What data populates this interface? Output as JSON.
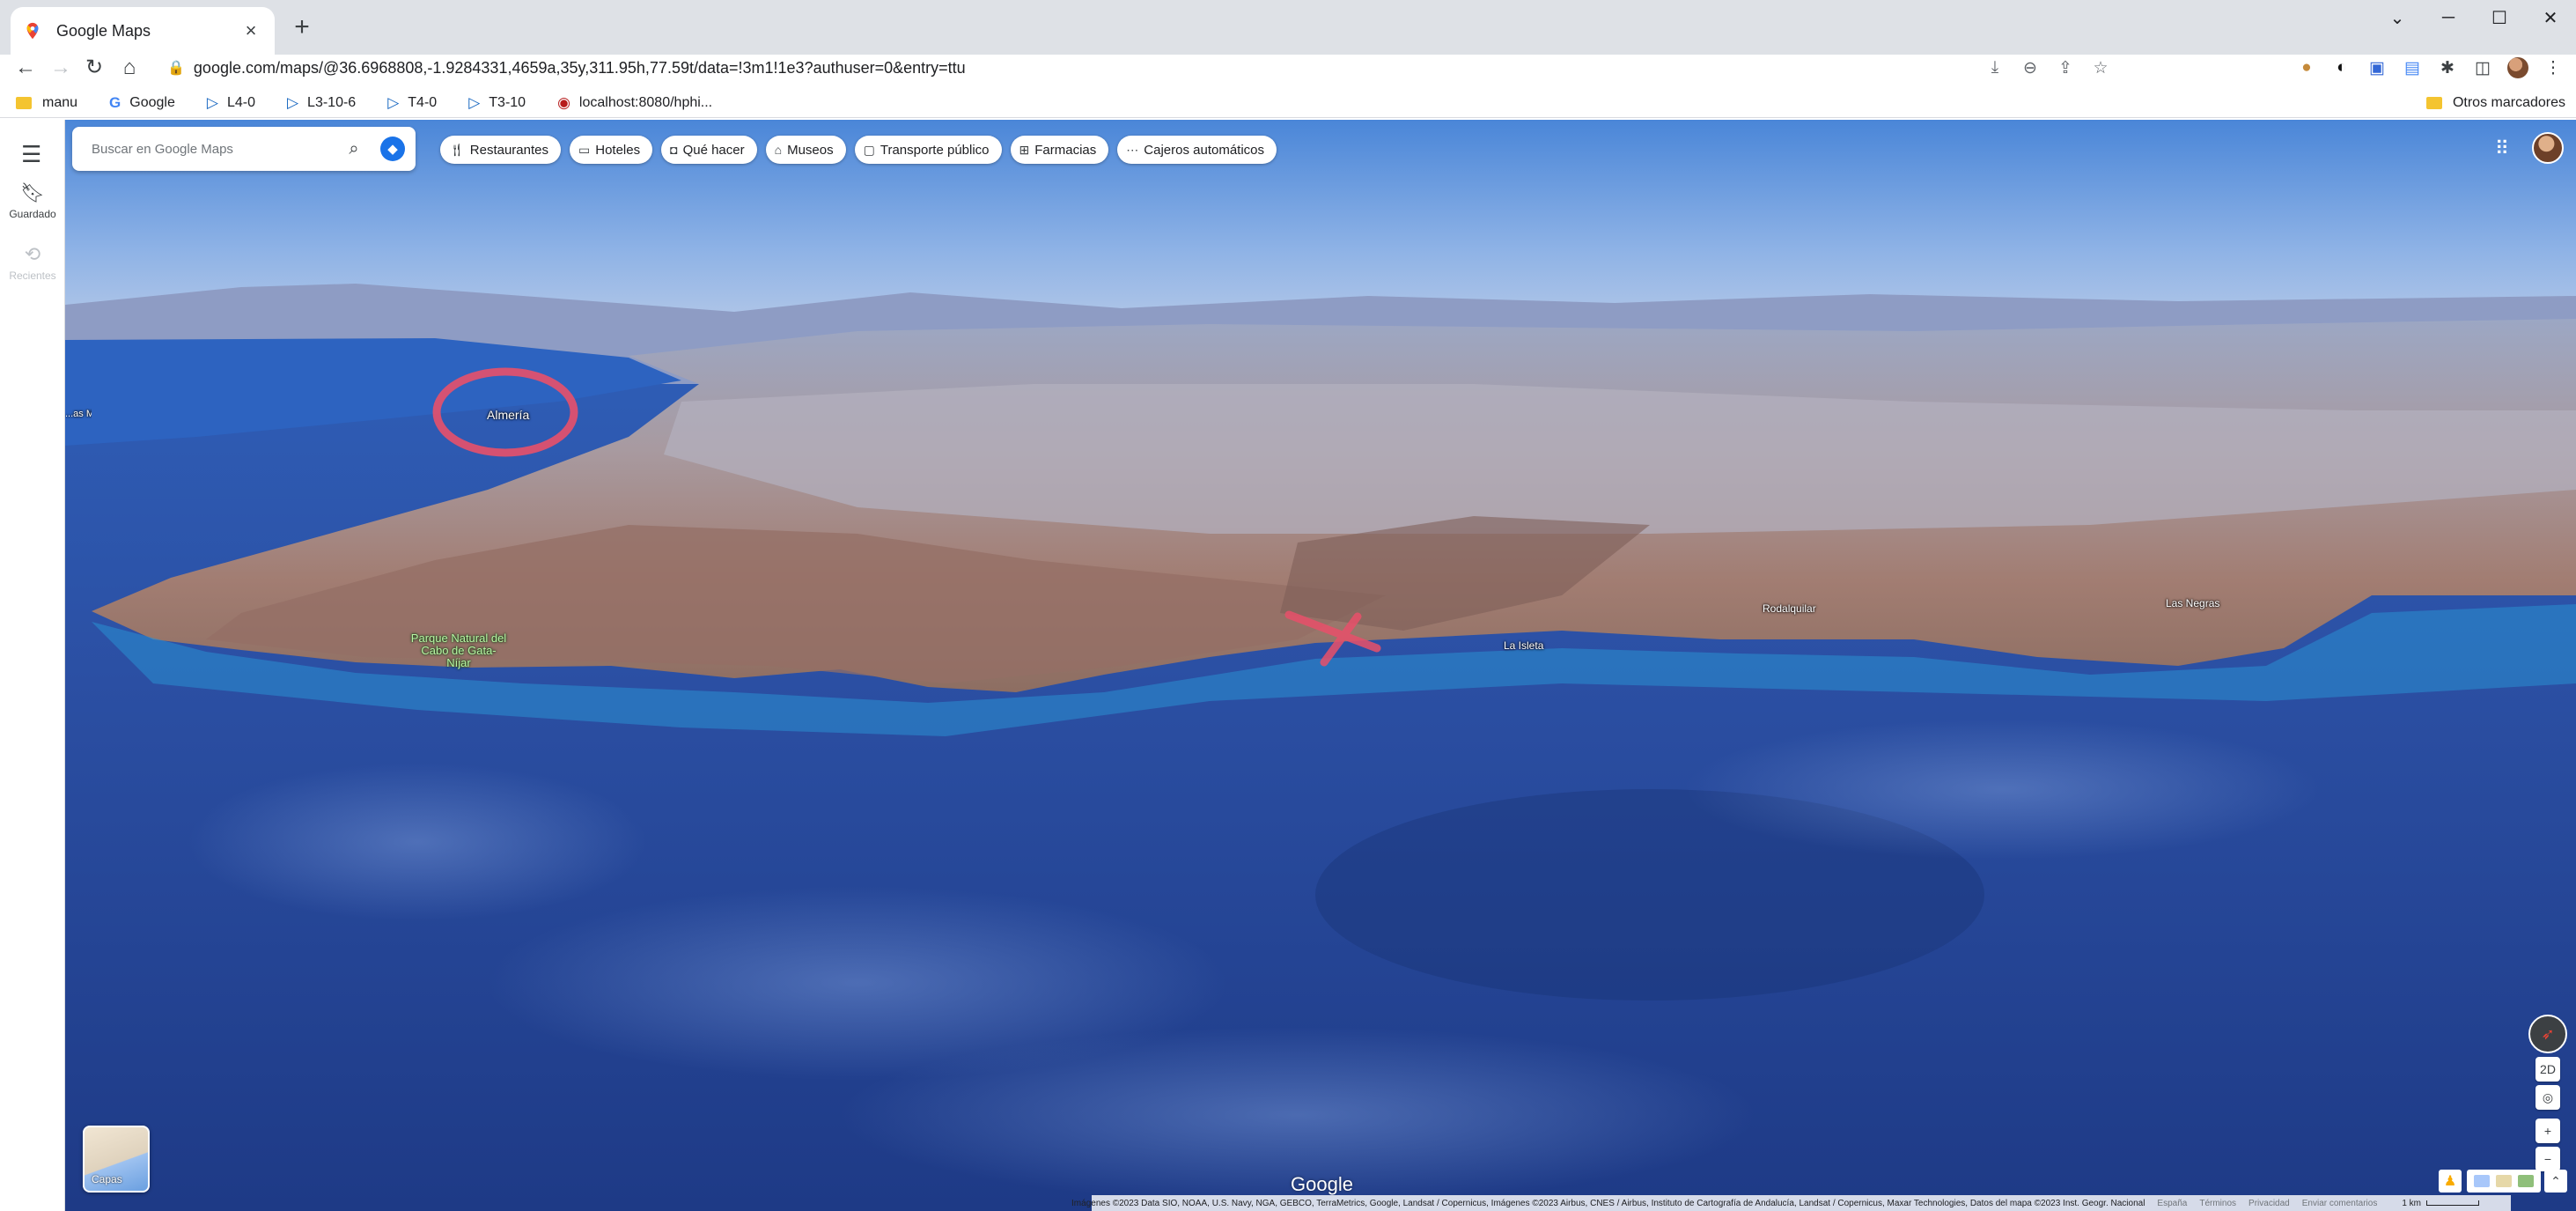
{
  "browser": {
    "tab_title": "Google Maps",
    "new_tab": "+",
    "url": "google.com/maps/@36.6968808,-1.9284331,4659a,35y,311.95h,77.59t/data=!3m1!1e3?authuser=0&entry=ttu",
    "bookmarks": [
      {
        "label": "manu",
        "icon": "folder-icon"
      },
      {
        "label": "Google",
        "icon": "google-icon"
      },
      {
        "label": "L4-0",
        "icon": "bookmark-logo-icon"
      },
      {
        "label": "L3-10-6",
        "icon": "bookmark-logo-icon"
      },
      {
        "label": "T4-0",
        "icon": "bookmark-logo-icon"
      },
      {
        "label": "T3-10",
        "icon": "bookmark-logo-icon"
      },
      {
        "label": "localhost:8080/hphi...",
        "icon": "site-icon"
      }
    ],
    "other_bookmarks": "Otros marcadores"
  },
  "maps": {
    "rail": {
      "saved_label": "Guardado",
      "recent_label": "Recientes"
    },
    "search_placeholder": "Buscar en Google Maps",
    "chips": [
      {
        "label": "Restaurantes",
        "icon": "fork-knife-icon"
      },
      {
        "label": "Hoteles",
        "icon": "bed-icon"
      },
      {
        "label": "Qué hacer",
        "icon": "camera-icon"
      },
      {
        "label": "Museos",
        "icon": "museum-icon"
      },
      {
        "label": "Transporte público",
        "icon": "bus-icon"
      },
      {
        "label": "Farmacias",
        "icon": "pharmacy-icon"
      },
      {
        "label": "Cajeros automáticos",
        "icon": "atm-icon"
      }
    ],
    "places": {
      "almeria": "Almería",
      "left_edge": "...as Mar",
      "cabo_de_gata": "Parque Natural del Cabo de Gata-Níjar",
      "la_isleta": "La Isleta",
      "rodalquilar": "Rodalquilar",
      "las_negras": "Las Negras"
    },
    "layers_label": "Capas",
    "wordmark": "Google",
    "view_mode": "2D",
    "footer": {
      "attribution": "Imágenes ©2023 Data SIO, NOAA, U.S. Navy, NGA, GEBCO, TerraMetrics, Google, Landsat / Copernicus, Imágenes ©2023 Airbus, CNES / Airbus, Instituto de Cartografía de Andalucía, Landsat / Copernicus, Maxar Technologies, Datos del mapa ©2023 Inst. Geogr. Nacional",
      "country": "España",
      "terms": "Términos",
      "privacy": "Privacidad",
      "feedback": "Enviar comentarios",
      "scale": "1 km"
    },
    "annotations": {
      "circle_color": "#e8506a",
      "cross_color": "#e8506a"
    }
  }
}
